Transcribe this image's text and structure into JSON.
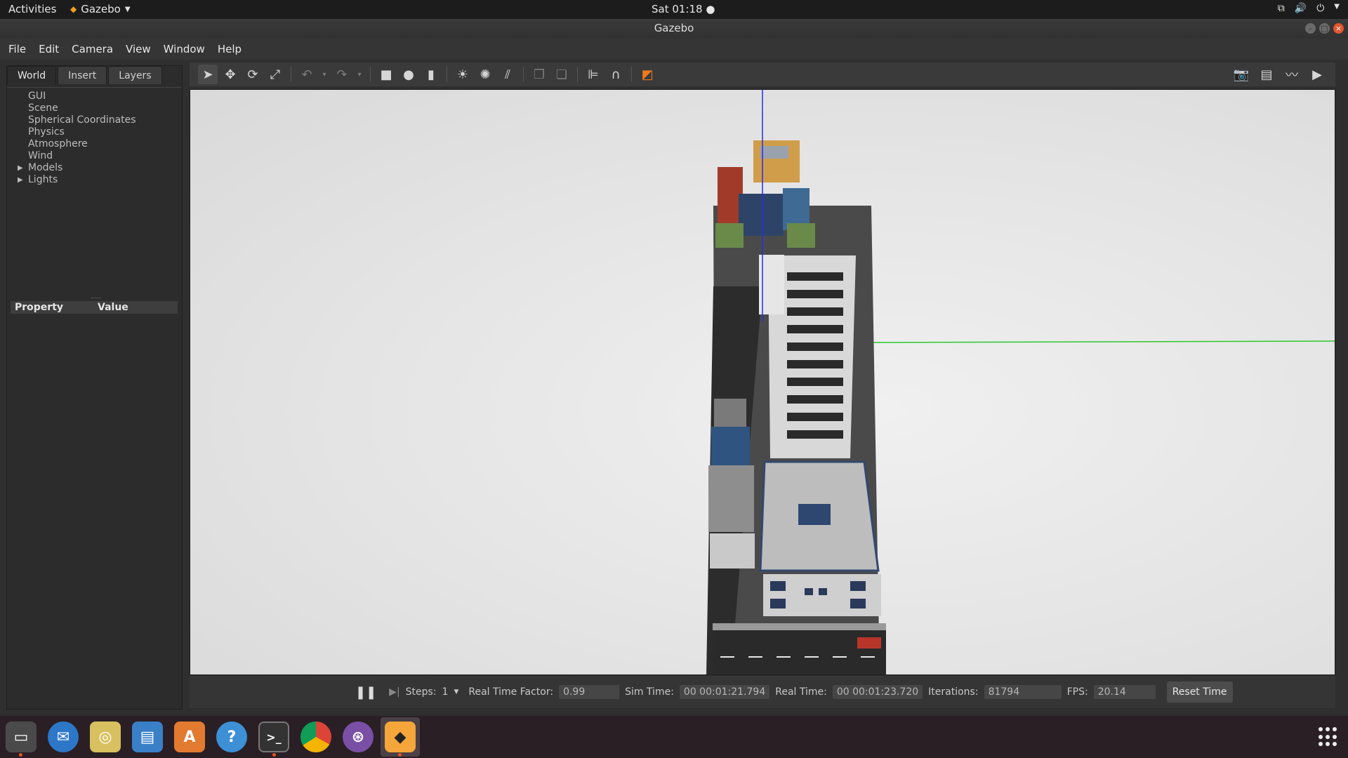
{
  "topbar": {
    "activities": "Activities",
    "app_name": "Gazebo",
    "clock": "Sat 01:18 ●"
  },
  "window": {
    "title": "Gazebo"
  },
  "menu": [
    "File",
    "Edit",
    "Camera",
    "View",
    "Window",
    "Help"
  ],
  "left_panel": {
    "tabs": [
      "World",
      "Insert",
      "Layers"
    ],
    "active_tab": "World",
    "tree": [
      {
        "label": "GUI",
        "expandable": false
      },
      {
        "label": "Scene",
        "expandable": false
      },
      {
        "label": "Spherical Coordinates",
        "expandable": false
      },
      {
        "label": "Physics",
        "expandable": false
      },
      {
        "label": "Atmosphere",
        "expandable": false
      },
      {
        "label": "Wind",
        "expandable": false
      },
      {
        "label": "Models",
        "expandable": true
      },
      {
        "label": "Lights",
        "expandable": true
      }
    ],
    "property_header": {
      "property": "Property",
      "value": "Value"
    }
  },
  "toolbar": {
    "tools": [
      "select-arrow-icon",
      "translate-icon",
      "rotate-icon",
      "scale-icon",
      "undo-icon",
      "redo-icon",
      "box-icon",
      "sphere-icon",
      "cylinder-icon",
      "point-light-icon",
      "spot-light-icon",
      "directional-light-icon",
      "copy-icon",
      "paste-icon",
      "align-icon",
      "snap-icon",
      "view-angle-icon"
    ],
    "right_tools": [
      "screenshot-icon",
      "log-icon",
      "plot-icon",
      "video-record-icon"
    ]
  },
  "status": {
    "steps_label": "Steps:",
    "steps_value": "1",
    "rtf_label": "Real Time Factor:",
    "rtf_value": "0.99",
    "sim_time_label": "Sim Time:",
    "sim_time_value": "00 00:01:21.794",
    "real_time_label": "Real Time:",
    "real_time_value": "00 00:01:23.720",
    "iterations_label": "Iterations:",
    "iterations_value": "81794",
    "fps_label": "FPS:",
    "fps_value": "20.14",
    "reset_label": "Reset Time"
  },
  "dock": [
    "files-icon",
    "thunderbird-icon",
    "rhythmbox-icon",
    "writer-icon",
    "software-center-icon",
    "help-icon",
    "terminal-icon",
    "chrome-icon",
    "github-desktop-icon",
    "gazebo-icon"
  ]
}
